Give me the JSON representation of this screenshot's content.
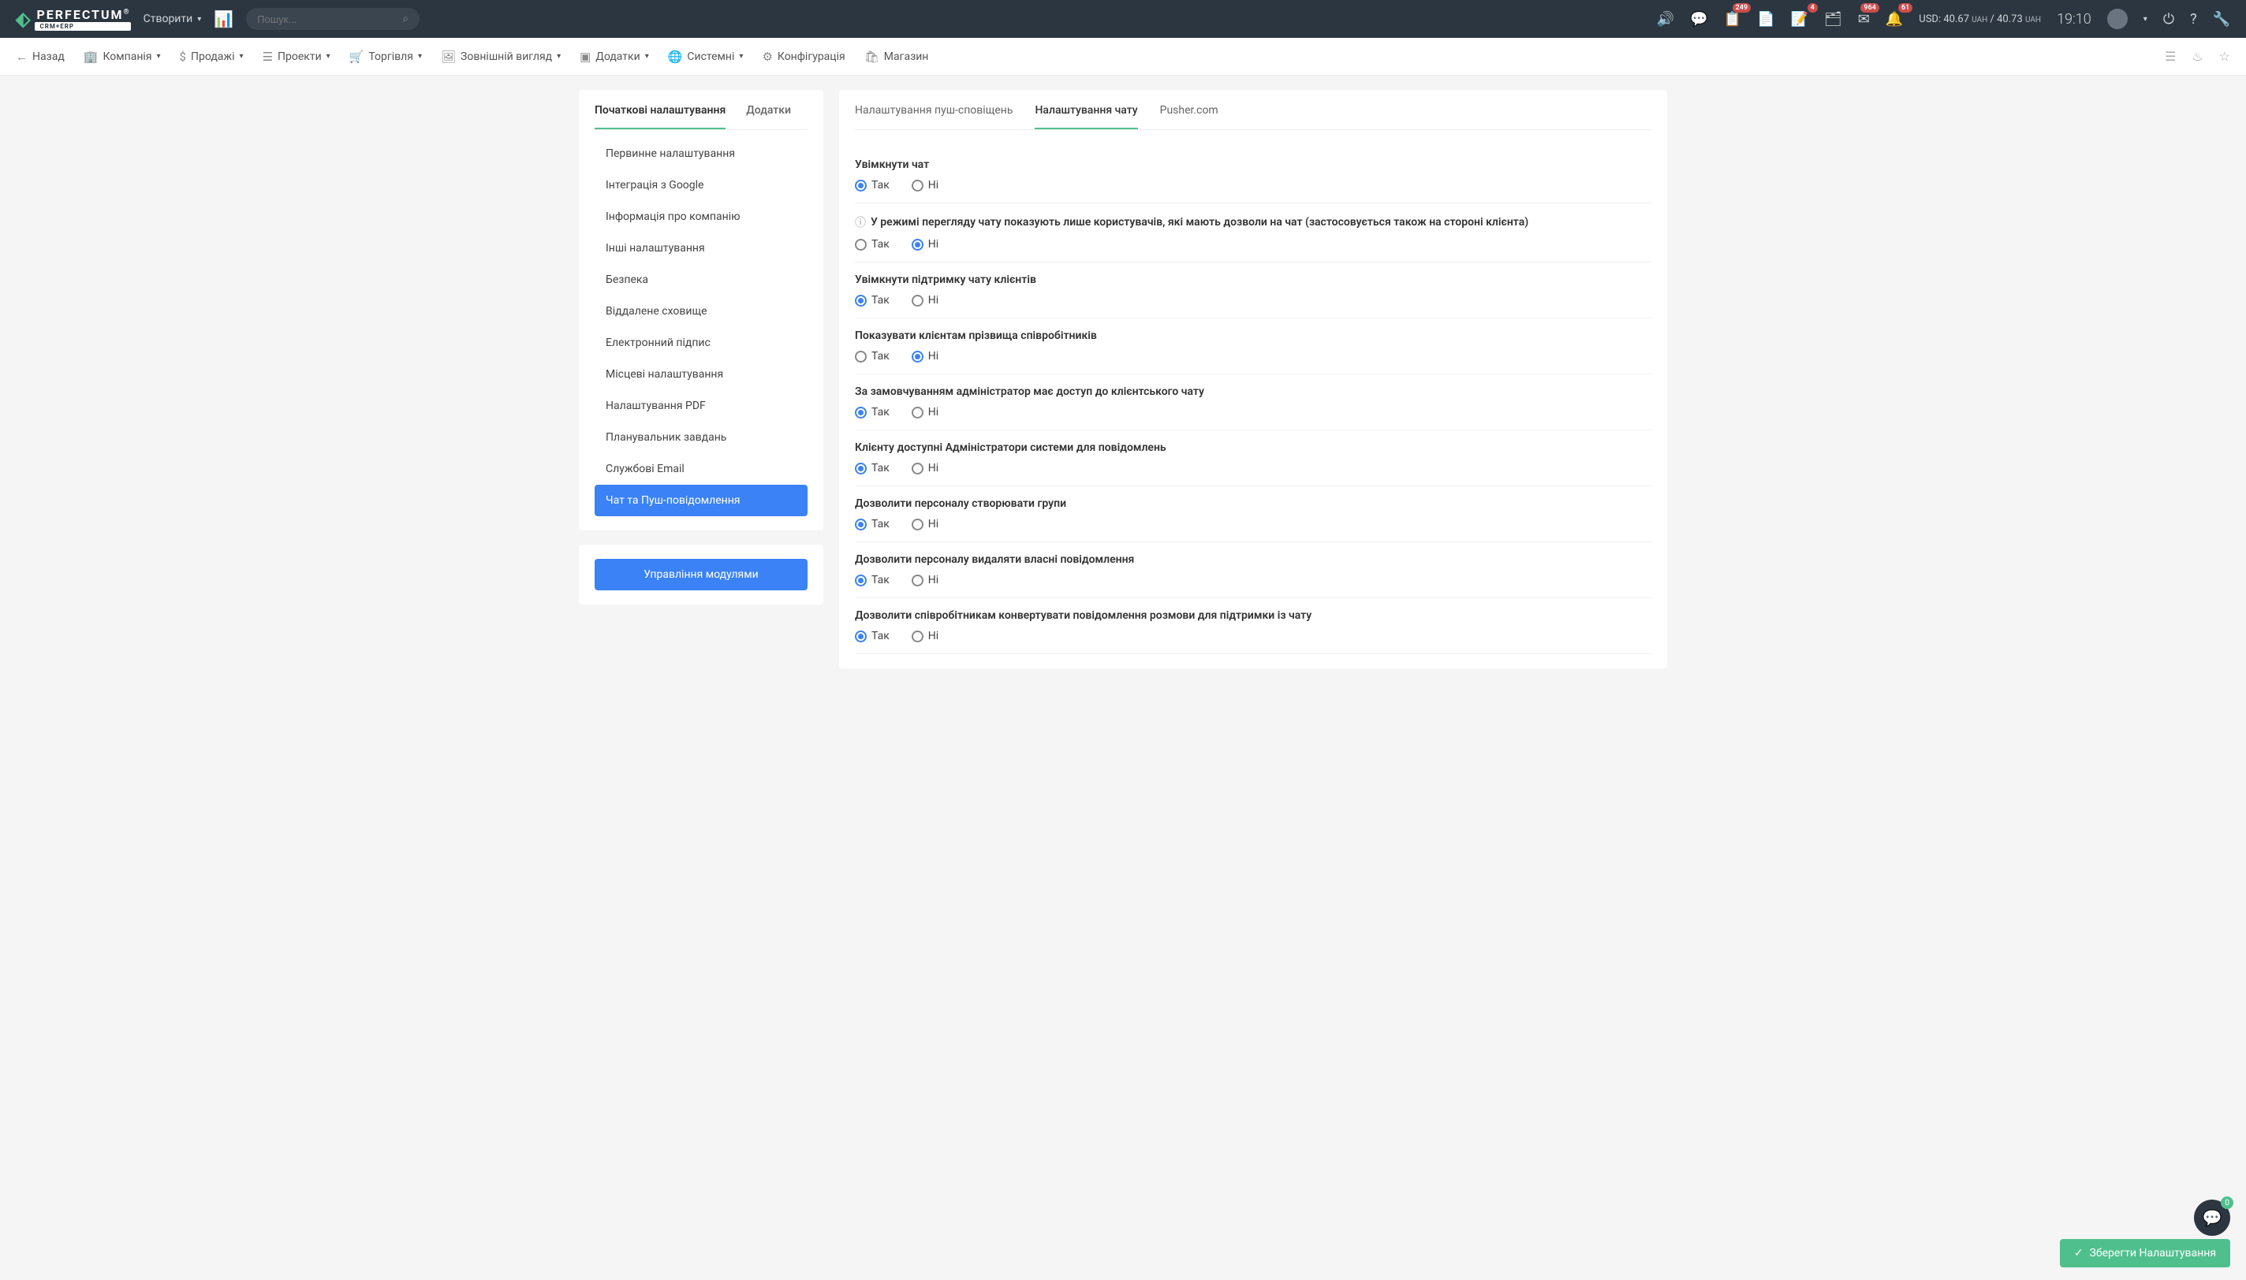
{
  "header": {
    "logo_text": "PERFECTUM",
    "logo_sub": "CRM+ERP",
    "create": "Створити",
    "search_placeholder": "Пошук...",
    "badges": {
      "b1": "249",
      "b2": "4",
      "b3": "964",
      "b4": "61"
    },
    "currency_label": "USD:",
    "rate1": "40.67",
    "rate2": "40.73",
    "cur_unit": "UAH",
    "sep": "/",
    "clock": "19:10",
    "chat_count": "0"
  },
  "nav": {
    "back": "Назад",
    "company": "Компанія",
    "sales": "Продажі",
    "projects": "Проекти",
    "trade": "Торгівля",
    "appearance": "Зовнішній вигляд",
    "addons": "Додатки",
    "system": "Системні",
    "config": "Конфігурація",
    "shop": "Магазин"
  },
  "sidebar": {
    "tab1": "Початкові налаштування",
    "tab2": "Додатки",
    "items": [
      "Первинне налаштування",
      "Інтеграція з Google",
      "Інформація про компанію",
      "Інші налаштування",
      "Безпека",
      "Віддалене сховище",
      "Електронний підпис",
      "Місцеві налаштування",
      "Налаштування PDF",
      "Планувальник завдань",
      "Службові Email",
      "Чат та Пуш-повідомлення"
    ],
    "modules_btn": "Управління модулями"
  },
  "content": {
    "tabs": [
      "Налаштування пуш-сповіщень",
      "Налаштування чату",
      "Pusher.com"
    ],
    "yes": "Так",
    "no": "Ні",
    "settings": [
      {
        "label": "Увімкнути чат",
        "value": "yes",
        "help": false
      },
      {
        "label": "У режимі перегляду чату показують лише користувачів, які мають дозволи на чат (застосовується також на стороні клієнта)",
        "value": "no",
        "help": true
      },
      {
        "label": "Увімкнути підтримку чату клієнтів",
        "value": "yes",
        "help": false
      },
      {
        "label": "Показувати клієнтам прізвища співробітників",
        "value": "no",
        "help": false
      },
      {
        "label": "За замовчуванням адміністратор має доступ до клієнтського чату",
        "value": "yes",
        "help": false
      },
      {
        "label": "Клієнту доступні Адміністратори системи для повідомлень",
        "value": "yes",
        "help": false
      },
      {
        "label": "Дозволити персоналу створювати групи",
        "value": "yes",
        "help": false
      },
      {
        "label": "Дозволити персоналу видаляти власні повідомлення",
        "value": "yes",
        "help": false
      },
      {
        "label": "Дозволити співробітникам конвертувати повідомлення розмови для підтримки із чату",
        "value": "yes",
        "help": false
      }
    ]
  },
  "save_btn": "Зберегти Налаштування"
}
